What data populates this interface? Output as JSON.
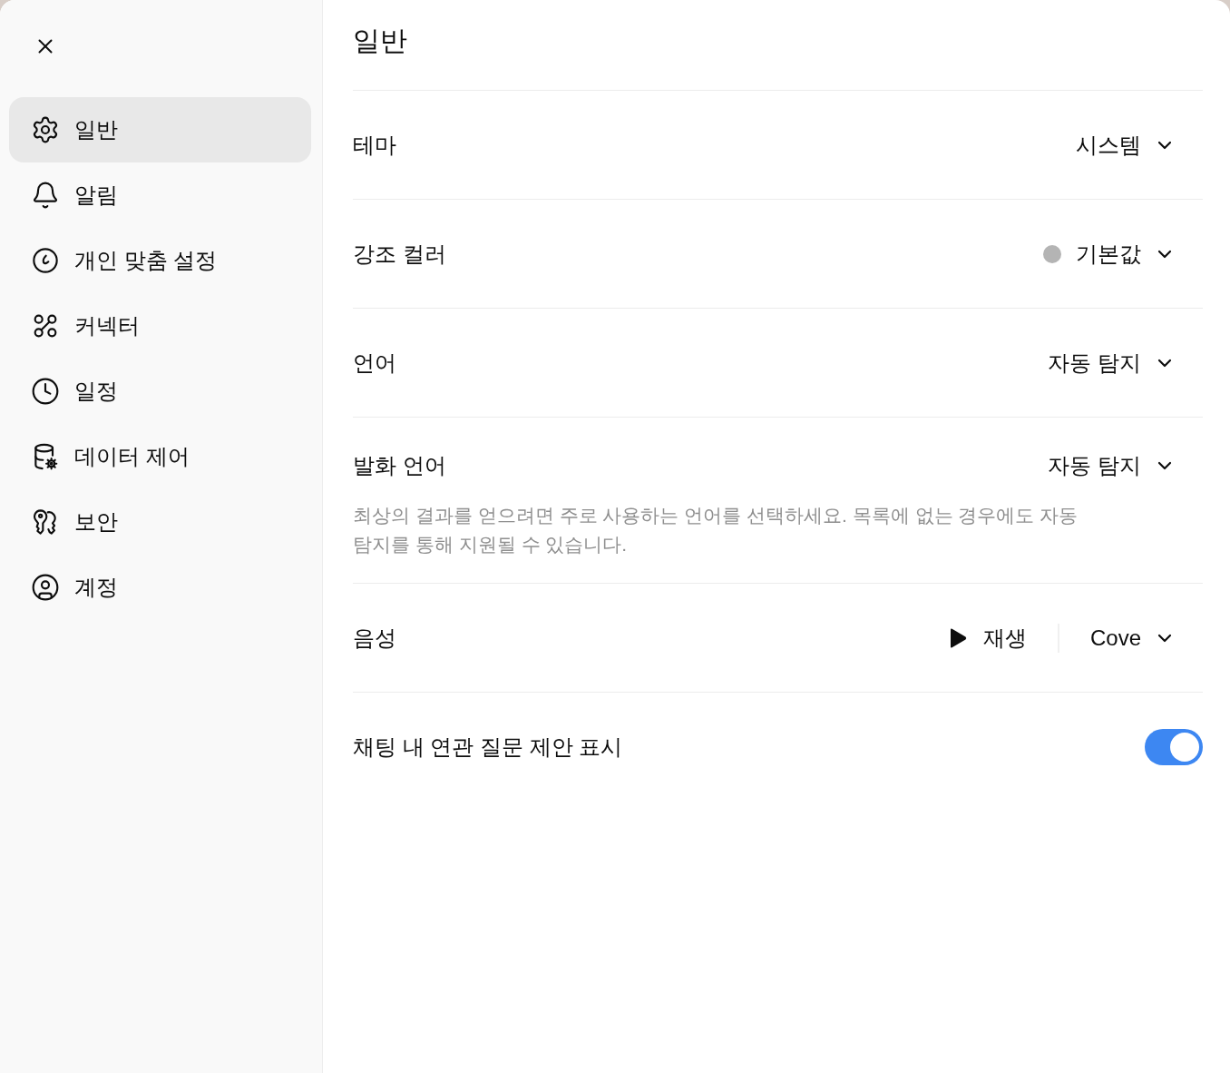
{
  "sidebar": {
    "items": [
      {
        "label": "일반",
        "selected": true
      },
      {
        "label": "알림",
        "selected": false
      },
      {
        "label": "개인 맞춤 설정",
        "selected": false
      },
      {
        "label": "커넥터",
        "selected": false
      },
      {
        "label": "일정",
        "selected": false
      },
      {
        "label": "데이터 제어",
        "selected": false
      },
      {
        "label": "보안",
        "selected": false
      },
      {
        "label": "계정",
        "selected": false
      }
    ]
  },
  "page": {
    "title": "일반"
  },
  "settings": [
    {
      "kind": "select",
      "label": "테마",
      "value": "시스템"
    },
    {
      "kind": "select",
      "label": "강조 컬러",
      "value": "기본값",
      "color": "#b4b4b4"
    },
    {
      "kind": "select",
      "label": "언어",
      "value": "자동 탐지"
    },
    {
      "kind": "select",
      "label": "발화 언어",
      "value": "자동 탐지",
      "description": "최상의 결과를 얻으려면 주로 사용하는 언어를 선택하세요. 목록에 없는 경우에도 자동 탐지를 통해 지원될 수 있습니다."
    },
    {
      "kind": "voice",
      "label": "음성",
      "play_label": "재생",
      "value": "Cove"
    },
    {
      "kind": "toggle",
      "label": "채팅 내 연관 질문 제안 표시",
      "on": true
    }
  ]
}
